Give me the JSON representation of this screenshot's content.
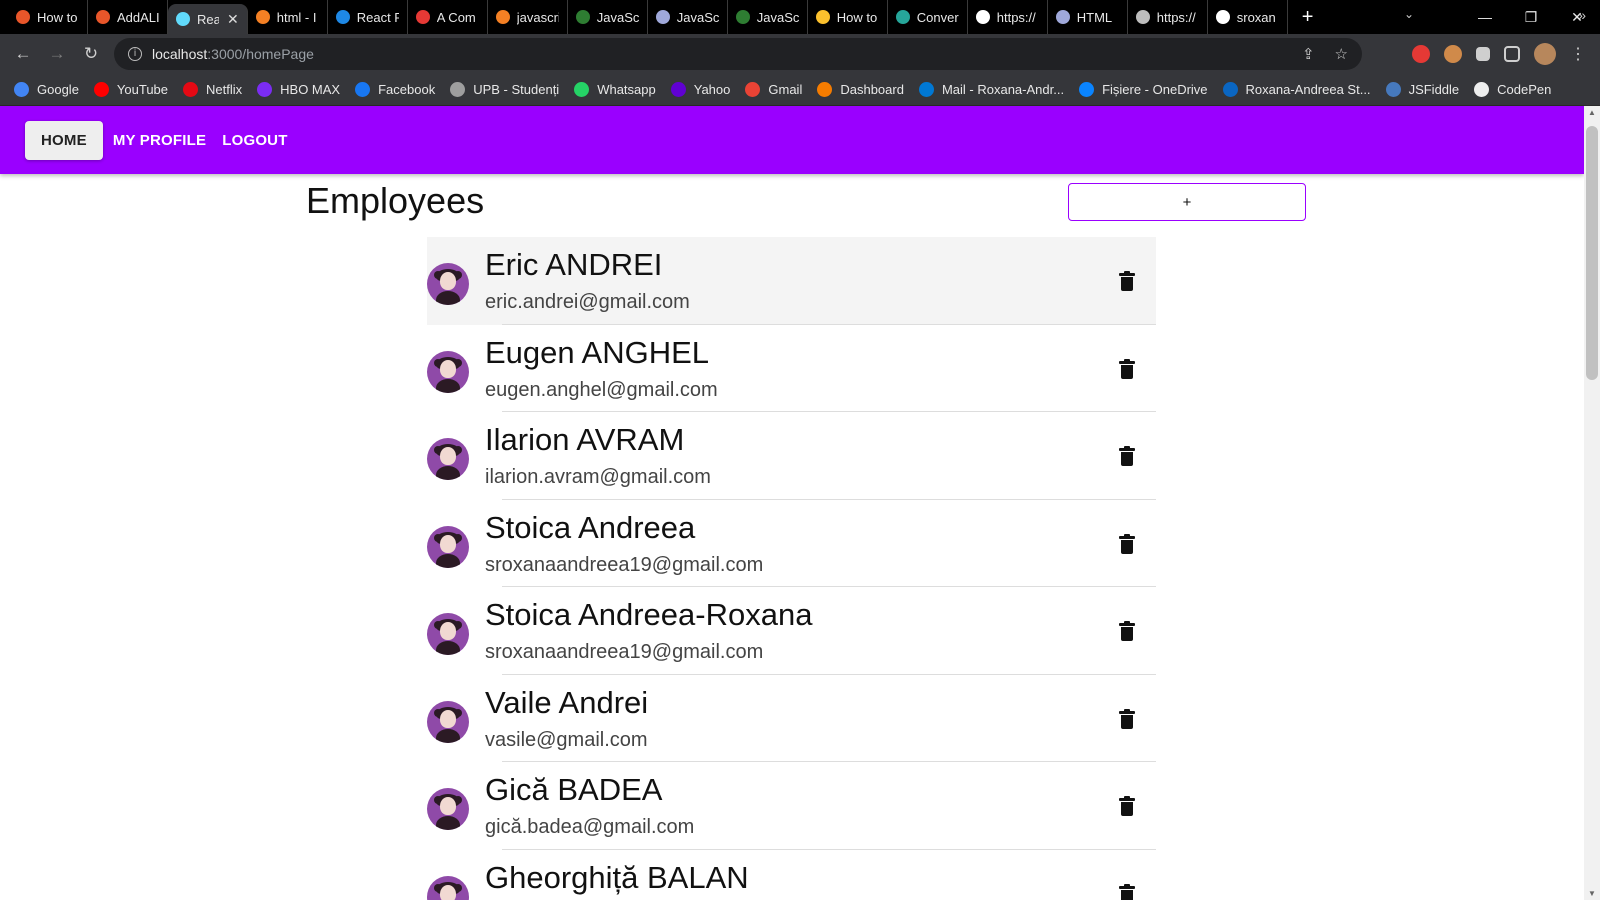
{
  "browser": {
    "tabs": [
      {
        "title": "How to",
        "color": "#e8562a"
      },
      {
        "title": "AddALI",
        "color": "#e8562a"
      },
      {
        "title": "Rea",
        "color": "#61dafb",
        "active": true
      },
      {
        "title": "html - I",
        "color": "#f48024"
      },
      {
        "title": "React P",
        "color": "#1e88e5"
      },
      {
        "title": "A Com",
        "color": "#e53935"
      },
      {
        "title": "javascri",
        "color": "#f48024"
      },
      {
        "title": "JavaScr",
        "color": "#2e7d32"
      },
      {
        "title": "JavaScr",
        "color": "#9fa8da"
      },
      {
        "title": "JavaScr",
        "color": "#2e7d32"
      },
      {
        "title": "How to",
        "color": "#fbc02d"
      },
      {
        "title": "Conver",
        "color": "#26a69a"
      },
      {
        "title": "https://",
        "color": "#ffffff"
      },
      {
        "title": "HTML",
        "color": "#9fa8da"
      },
      {
        "title": "https://",
        "color": "#bdbdbd"
      },
      {
        "title": "sroxan",
        "color": "#ffffff"
      }
    ],
    "new_tab": "+",
    "tab_search": "⌄",
    "window_controls": {
      "minimize": "—",
      "restore": "❐",
      "close": "✕"
    },
    "url_host": "localhost",
    "url_rest": ":3000/homePage",
    "bookmarks": [
      {
        "label": "Google",
        "color": "#4285f4"
      },
      {
        "label": "YouTube",
        "color": "#ff0000"
      },
      {
        "label": "Netflix",
        "color": "#e50914"
      },
      {
        "label": "HBO MAX",
        "color": "#7b2cf3"
      },
      {
        "label": "Facebook",
        "color": "#1877f2"
      },
      {
        "label": "UPB - Studenți",
        "color": "#9e9e9e"
      },
      {
        "label": "Whatsapp",
        "color": "#25d366"
      },
      {
        "label": "Yahoo",
        "color": "#6001d2"
      },
      {
        "label": "Gmail",
        "color": "#ea4335"
      },
      {
        "label": "Dashboard",
        "color": "#f57c00"
      },
      {
        "label": "Mail - Roxana-Andr...",
        "color": "#0078d4"
      },
      {
        "label": "Fișiere - OneDrive",
        "color": "#0a84ff"
      },
      {
        "label": "Roxana-Andreea St...",
        "color": "#0a66c2"
      },
      {
        "label": "JSFiddle",
        "color": "#4679bd"
      },
      {
        "label": "CodePen",
        "color": "#eeeeee"
      }
    ],
    "bookmarks_more": "»"
  },
  "nav": {
    "home": "HOME",
    "profile": "MY PROFILE",
    "logout": "LOGOUT"
  },
  "page": {
    "title": "Employees",
    "add_label": "+"
  },
  "employees": [
    {
      "name": "Eric ANDREI",
      "email": "eric.andrei@gmail.com"
    },
    {
      "name": "Eugen ANGHEL",
      "email": "eugen.anghel@gmail.com"
    },
    {
      "name": "Ilarion AVRAM",
      "email": "ilarion.avram@gmail.com"
    },
    {
      "name": "Stoica Andreea",
      "email": "sroxanaandreea19@gmail.com"
    },
    {
      "name": "Stoica Andreea-Roxana",
      "email": "sroxanaandreea19@gmail.com"
    },
    {
      "name": "Vaile Andrei",
      "email": "vasile@gmail.com"
    },
    {
      "name": "Gică BADEA",
      "email": "gică.badea@gmail.com"
    },
    {
      "name": "Gheorghiță BALAN",
      "email": ""
    }
  ],
  "colors": {
    "accent": "#9a00ff",
    "avatar_bg": "#8f4aa8"
  }
}
